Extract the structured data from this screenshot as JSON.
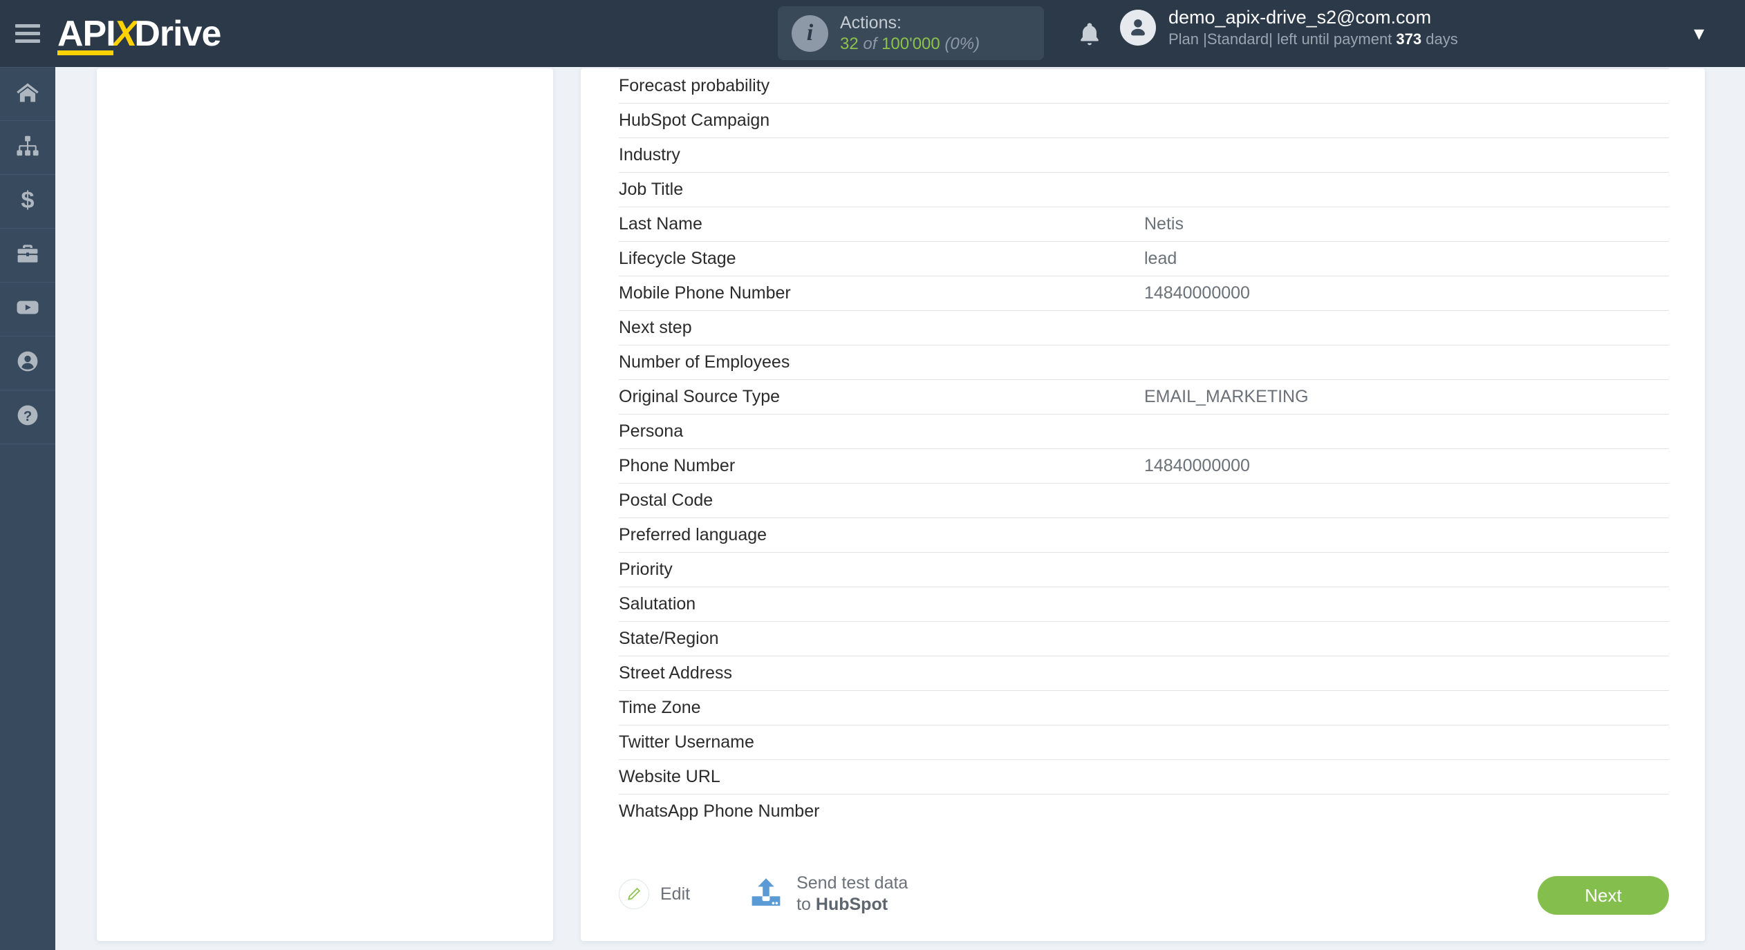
{
  "header": {
    "logo_api": "API",
    "logo_x": "X",
    "logo_drive": "Drive",
    "menu_icon": "hamburger-icon",
    "actions": {
      "title": "Actions:",
      "used": "32",
      "of": "of",
      "limit": "100'000",
      "percent": "(0%)"
    },
    "notifications_icon": "bell-icon",
    "user": {
      "email": "demo_apix-drive_s2@com.com",
      "plan_prefix": "Plan |",
      "plan_name": "Standard",
      "plan_suffix": "| left until payment",
      "days_value": "373",
      "days_unit": "days"
    },
    "dropdown_icon": "chevron-down-icon"
  },
  "sidebar": {
    "items": [
      {
        "name": "home",
        "icon": "home-icon"
      },
      {
        "name": "connections",
        "icon": "sitemap-icon"
      },
      {
        "name": "billing",
        "icon": "dollar-icon"
      },
      {
        "name": "partners",
        "icon": "briefcase-icon"
      },
      {
        "name": "video",
        "icon": "youtube-icon"
      },
      {
        "name": "account",
        "icon": "user-circle-icon"
      },
      {
        "name": "help",
        "icon": "question-circle-icon"
      }
    ]
  },
  "fields": {
    "rows": [
      {
        "label": "Forecast probability",
        "value": ""
      },
      {
        "label": "HubSpot Campaign",
        "value": ""
      },
      {
        "label": "Industry",
        "value": ""
      },
      {
        "label": "Job Title",
        "value": ""
      },
      {
        "label": "Last Name",
        "value": "Netis"
      },
      {
        "label": "Lifecycle Stage",
        "value": "lead"
      },
      {
        "label": "Mobile Phone Number",
        "value": "14840000000"
      },
      {
        "label": "Next step",
        "value": ""
      },
      {
        "label": "Number of Employees",
        "value": ""
      },
      {
        "label": "Original Source Type",
        "value": "EMAIL_MARKETING"
      },
      {
        "label": "Persona",
        "value": ""
      },
      {
        "label": "Phone Number",
        "value": "14840000000"
      },
      {
        "label": "Postal Code",
        "value": ""
      },
      {
        "label": "Preferred language",
        "value": ""
      },
      {
        "label": "Priority",
        "value": ""
      },
      {
        "label": "Salutation",
        "value": ""
      },
      {
        "label": "State/Region",
        "value": ""
      },
      {
        "label": "Street Address",
        "value": ""
      },
      {
        "label": "Time Zone",
        "value": ""
      },
      {
        "label": "Twitter Username",
        "value": ""
      },
      {
        "label": "Website URL",
        "value": ""
      },
      {
        "label": "WhatsApp Phone Number",
        "value": ""
      }
    ]
  },
  "footer": {
    "edit_label": "Edit",
    "edit_icon": "pencil-icon",
    "send_icon": "upload-icon",
    "send_line1": "Send test data",
    "send_line2_prefix": "to",
    "send_line2_target": "HubSpot",
    "next_label": "Next"
  },
  "colors": {
    "topbar": "#2b3948",
    "rail": "#374a5e",
    "accent_yellow": "#ffd100",
    "accent_green": "#84bf4e",
    "counter_green": "#8bc34a",
    "page_bg": "#eef2f7"
  }
}
